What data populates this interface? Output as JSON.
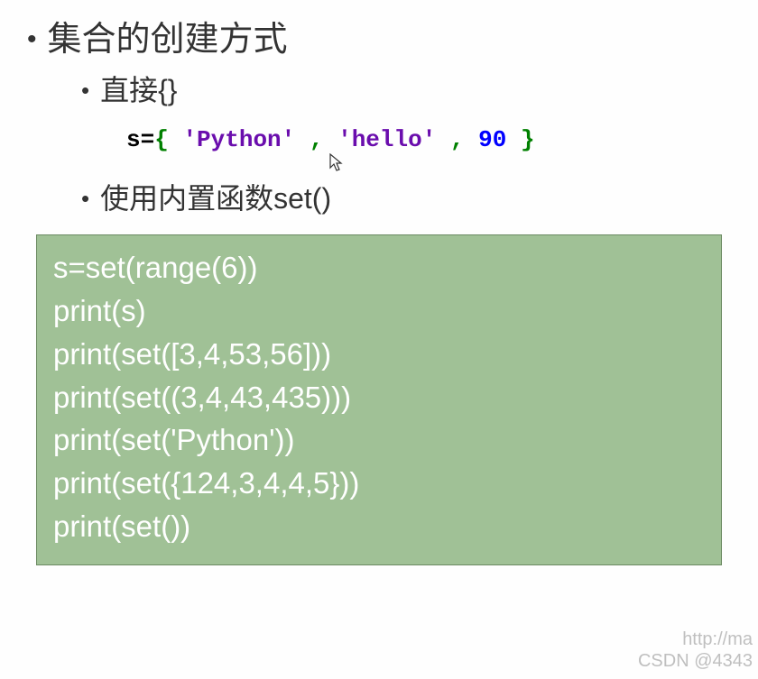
{
  "bullets": {
    "l1": "集合的创建方式",
    "l2a": "直接{}",
    "l2b": "使用内置函数set()"
  },
  "inline_code": {
    "var": "s=",
    "brace_open": "{",
    "sp1": "  ",
    "str1": "'Python'",
    "sp2": "  ",
    "comma1": ",",
    "sp3": " ",
    "str2": "'hello'",
    "sp4": "    ",
    "comma2": ",",
    "sp5": " ",
    "num": "90",
    "sp6": "    ",
    "brace_close": "}"
  },
  "code_block": {
    "lines": [
      "s=set(range(6))",
      "print(s)",
      "print(set([3,4,53,56]))",
      "print(set((3,4,43,435)))",
      "print(set('Python'))",
      "print(set({124,3,4,4,5}))",
      "print(set())"
    ]
  },
  "watermark": {
    "line1": "http://ma",
    "line2": "CSDN @4343"
  }
}
